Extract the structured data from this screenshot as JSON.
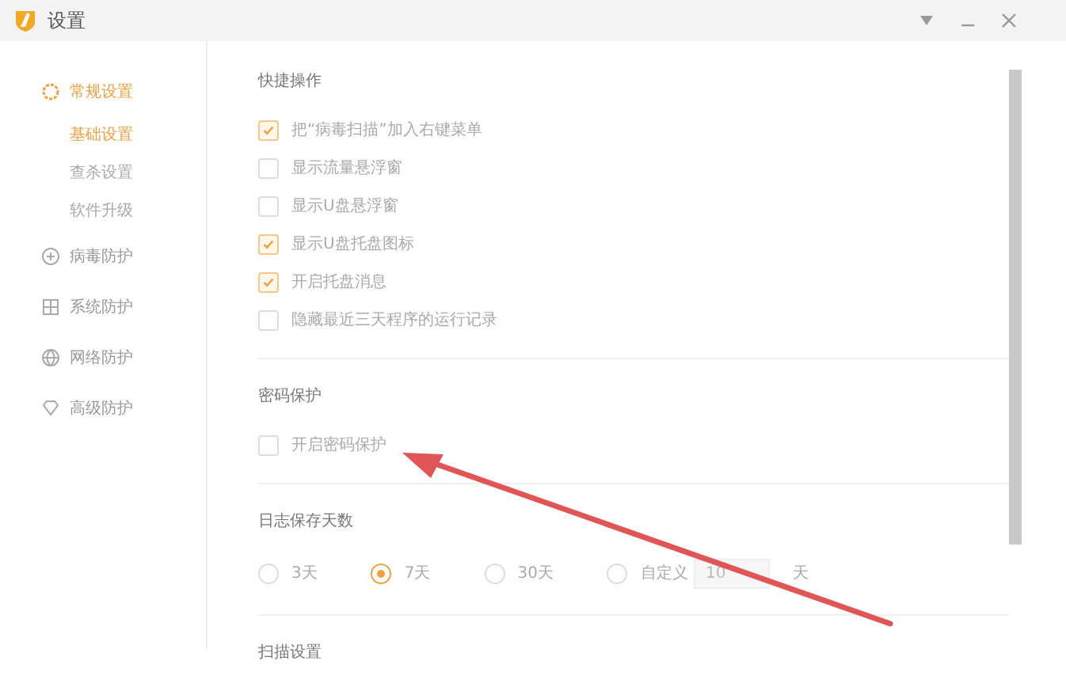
{
  "window": {
    "title": "设置"
  },
  "sidebar": {
    "items": [
      {
        "label": "常规设置",
        "selected": true,
        "children": [
          {
            "label": "基础设置",
            "selected": true
          },
          {
            "label": "查杀设置",
            "selected": false
          },
          {
            "label": "软件升级",
            "selected": false
          }
        ]
      },
      {
        "label": "病毒防护",
        "selected": false
      },
      {
        "label": "系统防护",
        "selected": false
      },
      {
        "label": "网络防护",
        "selected": false
      },
      {
        "label": "高级防护",
        "selected": false
      }
    ]
  },
  "sections": [
    {
      "title": "快捷操作",
      "kind": "checks",
      "options": [
        {
          "label": "把“病毒扫描”加入右键菜单",
          "checked": true
        },
        {
          "label": "显示流量悬浮窗",
          "checked": false
        },
        {
          "label": "显示U盘悬浮窗",
          "checked": false
        },
        {
          "label": "显示U盘托盘图标",
          "checked": true
        },
        {
          "label": "开启托盘消息",
          "checked": true
        },
        {
          "label": "隐藏最近三天程序的运行记录",
          "checked": false
        }
      ]
    },
    {
      "title": "密码保护",
      "kind": "checks",
      "options": [
        {
          "label": "开启密码保护",
          "checked": false
        }
      ]
    },
    {
      "title": "日志保存天数",
      "kind": "radios",
      "options": [
        {
          "label": "3天",
          "selected": false
        },
        {
          "label": "7天",
          "selected": true
        },
        {
          "label": "30天",
          "selected": false
        },
        {
          "label": "自定义",
          "selected": false,
          "field": "10",
          "unit": "天"
        }
      ]
    },
    {
      "title": "扫描设置",
      "kind": "checks"
    }
  ]
}
